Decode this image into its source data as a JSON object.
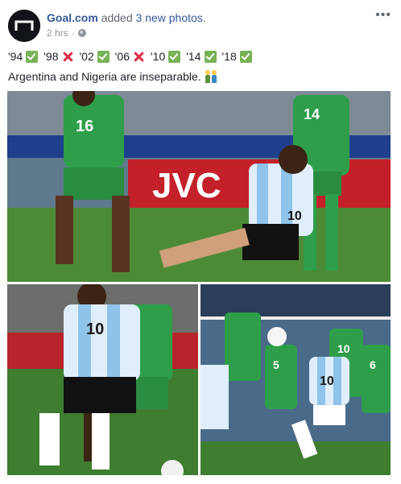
{
  "post": {
    "author": "Goal.com",
    "action": "added",
    "photo_count_text": "3 new photos",
    "period": ".",
    "time": "2 hrs",
    "separator": "·",
    "privacy_icon": "globe-icon",
    "more_icon": "ellipsis-icon"
  },
  "text": {
    "line1": [
      {
        "year": "'94",
        "mark": "check"
      },
      {
        "year": "'98",
        "mark": "cross"
      },
      {
        "year": "'02",
        "mark": "check"
      },
      {
        "year": "'06",
        "mark": "cross"
      },
      {
        "year": "'10",
        "mark": "check"
      },
      {
        "year": "'14",
        "mark": "check"
      },
      {
        "year": "'18",
        "mark": "check"
      }
    ],
    "line2": "Argentina and Nigeria are inseparable.",
    "line2_emoji": "two-people-icon"
  },
  "photos": {
    "main_numbers": {
      "nigeria_left": "16",
      "nigeria_right": "14",
      "argentina": "10",
      "sponsor": "JVC"
    },
    "left_numbers": {
      "argentina": "10"
    },
    "right_numbers": {
      "argentina": "10",
      "nigeria_a": "5",
      "nigeria_b": "10",
      "nigeria_c": "6"
    }
  },
  "colors": {
    "link": "#365899",
    "muted": "#90949c",
    "nigeria_green": "#2e9e4a",
    "argentina_blue": "#8fc3ea",
    "pitch": "#4d8a36",
    "ad_red": "#c4202a"
  }
}
